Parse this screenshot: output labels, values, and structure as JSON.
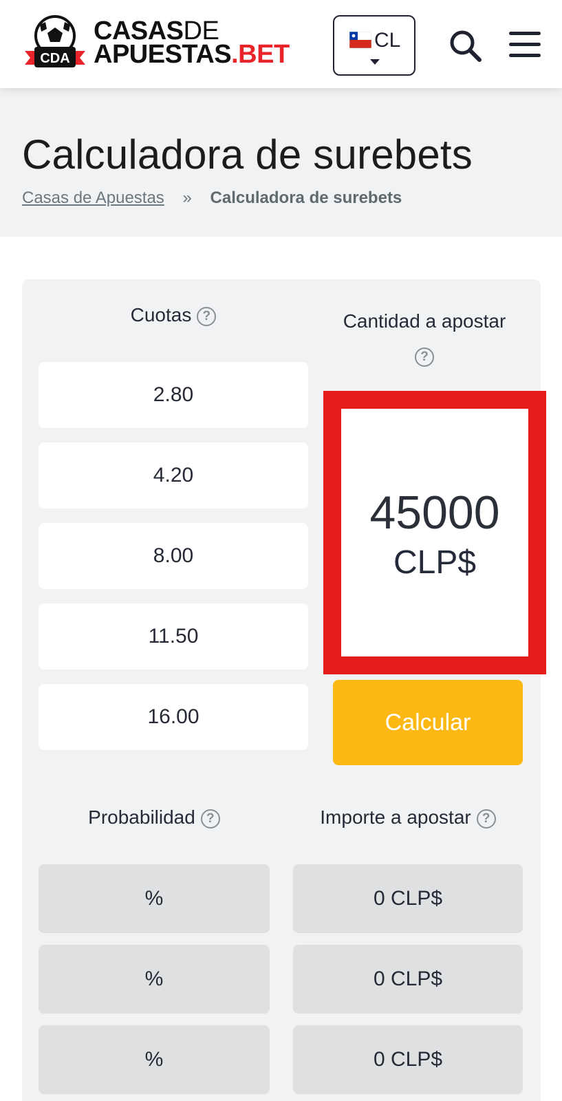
{
  "header": {
    "logo": {
      "badge_text": "CDA",
      "line1_bold": "CASAS",
      "line1_light": "DE",
      "line2_bold": "APUESTAS",
      "line2_red": ".BET"
    },
    "language": {
      "code": "CL"
    }
  },
  "page": {
    "title": "Calculadora de surebets",
    "breadcrumb": {
      "home": "Casas de Apuestas",
      "separator": "»",
      "current": "Calculadora de surebets"
    }
  },
  "calculator": {
    "odds_label": "Cuotas",
    "stake_label": "Cantidad a apostar",
    "odds": [
      "2.80",
      "4.20",
      "8.00",
      "11.50",
      "16.00"
    ],
    "stake": {
      "value": "45000",
      "currency": "CLP$"
    },
    "calculate_label": "Calcular",
    "probability_label": "Probabilidad",
    "amount_label": "Importe a apostar",
    "results": [
      {
        "probability": "%",
        "amount": "0 CLP$"
      },
      {
        "probability": "%",
        "amount": "0 CLP$"
      },
      {
        "probability": "%",
        "amount": "0 CLP$"
      }
    ],
    "help_glyph": "?"
  },
  "colors": {
    "accent_yellow": "#fdb813",
    "highlight_red": "#e51c1c",
    "brand_red": "#e8232a"
  }
}
